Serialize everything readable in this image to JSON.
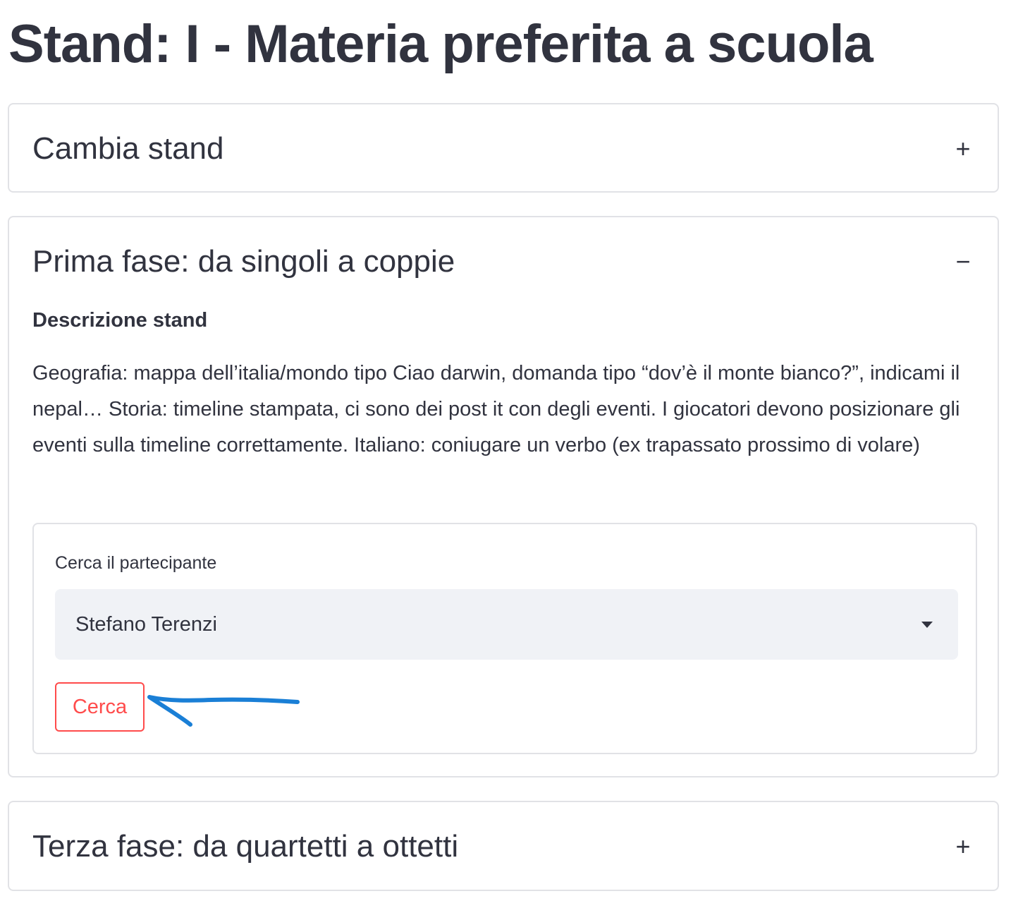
{
  "page": {
    "title": "Stand: I - Materia preferita a scuola"
  },
  "expanders": {
    "cambia": {
      "title": "Cambia stand",
      "toggle": "+",
      "expanded": false
    },
    "prima": {
      "title": "Prima fase: da singoli a coppie",
      "toggle": "−",
      "expanded": true
    },
    "terza": {
      "title": "Terza fase: da quartetti a ottetti",
      "toggle": "+",
      "expanded": false
    }
  },
  "prima_content": {
    "desc_label": "Descrizione stand",
    "desc_text": "Geografia: mappa dell’italia/mondo tipo Ciao darwin, domanda tipo “dov’è il monte bianco?”, indicami il nepal… Storia: timeline stampata, ci sono dei post it con degli eventi. I giocatori devono posizionare gli eventi sulla timeline correttamente. Italiano: coniugare un verbo (ex trapassato prossimo di volare)",
    "form": {
      "field_label": "Cerca il partecipante",
      "selected_value": "Stefano Terenzi",
      "button_label": "Cerca"
    }
  },
  "colors": {
    "text": "#31333f",
    "border": "#e1e2e6",
    "select_bg": "#f0f2f6",
    "primary_red": "#ff4b4b",
    "annotation_blue": "#1a7fd6"
  },
  "icons": {
    "caret": "chevron-down-icon",
    "expand": "plus-icon",
    "collapse": "minus-icon",
    "annotation": "arrow-annotation-icon"
  }
}
